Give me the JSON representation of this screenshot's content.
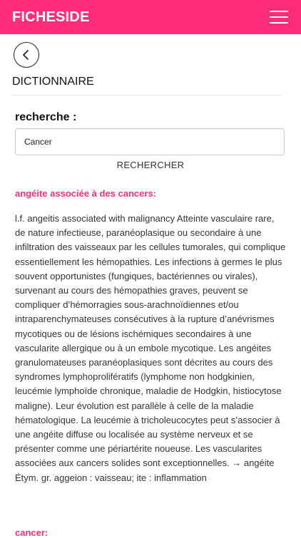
{
  "header": {
    "app_title": "FICHESIDE",
    "menu_icon": "hamburger-menu-icon",
    "background": "#ff2d78"
  },
  "nav": {
    "back_icon": "chevron-left-icon",
    "page_title": "DICTIONNAIRE"
  },
  "search": {
    "label": "recherche :",
    "value": "Cancer",
    "button_label": "RECHERCHER"
  },
  "results": [
    {
      "term": "angéite associée à des cancers:",
      "definition": "l.f. angeitis associated with malignancy Atteinte vasculaire rare, de nature infectieuse, paranéoplasique ou secondaire à une infiltration des vaisseaux par les cellules tumorales, qui complique essentiellement les hémopathies. Les infections à germes le plus souvent opportunistes (fungiques, bactériennes ou virales), survenant au cours des hémopathies graves, peuvent se compliquer d’hémorragies sous-arachnoïdiennes et/ou intraparenchymateuses consécutives à la rupture d’anévrismes mycotiques ou de lésions ischémiques secondaires à une vascularite allergique ou à un embole mycotique. Les angéites granulomateuses paranéoplasiques sont décrites au cours des syndromes lymphoprolifératifs (lymphome non hodgkinien, leucémie lymphoïde chronique, maladie de Hodgkin, histiocytose maligne). Leur évolution est parallèle à celle de la maladie hématologique. La leucémie à tricholeucocytes peut s’associer à une angéite diffuse ou localisée au système nerveux et se présenter comme une périartérite noueuse. Les vascularites associées aux cancers solides sont exceptionnelles. → angéite Étym. gr. aggeion : vaisseau; ite : inflammation"
    },
    {
      "term": "cancer:"
    }
  ]
}
